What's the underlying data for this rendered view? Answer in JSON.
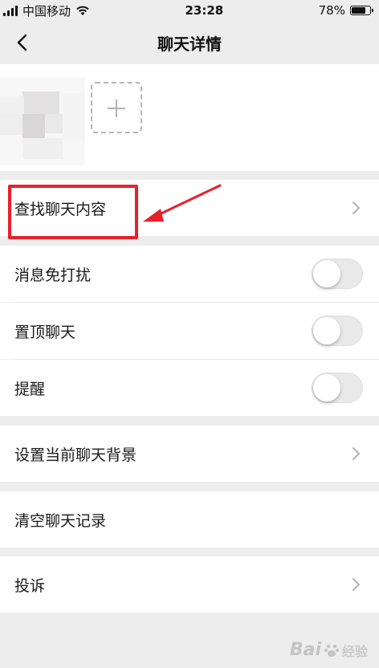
{
  "status_bar": {
    "carrier": "中国移动",
    "time": "23:28",
    "battery_percent": "78%",
    "battery_level": 0.78,
    "icons": [
      "signal-icon",
      "wifi-icon",
      "battery-icon"
    ]
  },
  "nav": {
    "title": "聊天详情",
    "back_icon": "chevron-left-icon"
  },
  "members": {
    "add_icon": "plus-icon"
  },
  "cells": {
    "find_content": "查找聊天内容",
    "mute": "消息免打扰",
    "pin": "置顶聊天",
    "remind": "提醒",
    "background": "设置当前聊天背景",
    "clear": "清空聊天记录",
    "complain": "投诉"
  },
  "toggles": {
    "mute": false,
    "pin": false,
    "remind": false
  },
  "watermark": {
    "brand": "Bai",
    "sub": "经验"
  },
  "colors": {
    "background": "#ededed",
    "cell": "#ffffff",
    "highlight": "#e8212c",
    "toggle_off": "#e9e9ea"
  }
}
